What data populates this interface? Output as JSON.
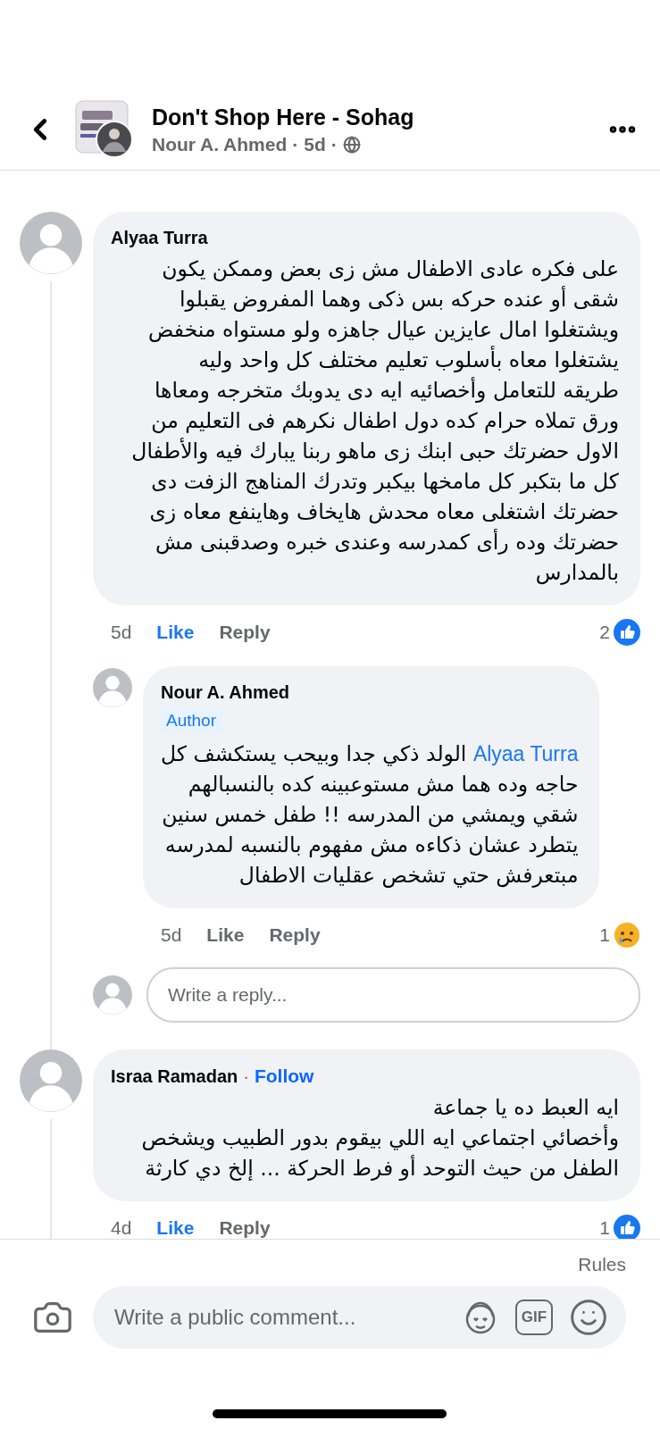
{
  "header": {
    "title": "Don't Shop Here - Sohag",
    "author": "Nour A. Ahmed",
    "separator": "·",
    "time": "5d"
  },
  "comments": [
    {
      "author": "Alyaa Turra",
      "text": "على فكره عادى الاطفال مش زى بعض وممكن يكون\nشقى أو عنده حركه بس ذكى وهما المفروض يقبلوا\nويشتغلوا امال عايزين عيال جاهزه ولو مستواه منخفض\nيشتغلوا معاه بأسلوب تعليم مختلف كل واحد وليه\nطريقه للتعامل وأخصائيه ايه دى يدوبك متخرجه ومعاها\nورق تملاه حرام كده دول اطفال نكرهم فى التعليم من\nالاول حضرتك حبى ابنك زى ماهو ربنا يبارك فيه والأطفال\nكل ما بتكبر كل مامخها بيكبر وتدرك المناهج الزفت دى\nحضرتك اشتغلى معاه محدش هايخاف وهاينفع معاه زى\nحضرتك وده رأى كمدرسه وعندى خبره وصدقبنى مش\nبالمدارس",
      "time": "5d",
      "like": "Like",
      "liked": true,
      "reply": "Reply",
      "reaction": {
        "count": "2",
        "kind": "like"
      },
      "replies": [
        {
          "author": "Nour A. Ahmed",
          "badge": "Author",
          "mention": "Alyaa Turra",
          "text": "الولد ذكي جدا وبيحب يستكشف كل\nحاجه وده هما مش مستوعبينه كده بالنسبالهم\nشقي ويمشي من المدرسه !! طفل خمس سنين\nيتطرد عشان ذكاءه مش مفهوم بالنسبه لمدرسه\nمبتعرفش حتي تشخص عقليات الاطفال",
          "time": "5d",
          "like": "Like",
          "liked": false,
          "reply": "Reply",
          "reaction": {
            "count": "1",
            "kind": "sad"
          }
        }
      ],
      "reply_field": {
        "placeholder": "Write a reply..."
      }
    },
    {
      "author": "Israa Ramadan",
      "separator": "·",
      "follow": "Follow",
      "text": "ايه العبط ده يا جماعة\nوأخصائي اجتماعي ايه اللي بيقوم بدور الطبيب ويشخص\nالطفل من حيث التوحد أو فرط الحركة ... إلخ دي كارثة",
      "time": "4d",
      "like": "Like",
      "liked": true,
      "reply": "Reply",
      "reaction": {
        "count": "1",
        "kind": "like"
      }
    }
  ],
  "footer": {
    "rules": "Rules",
    "placeholder": "Write a public comment...",
    "gif_label": "GIF"
  }
}
